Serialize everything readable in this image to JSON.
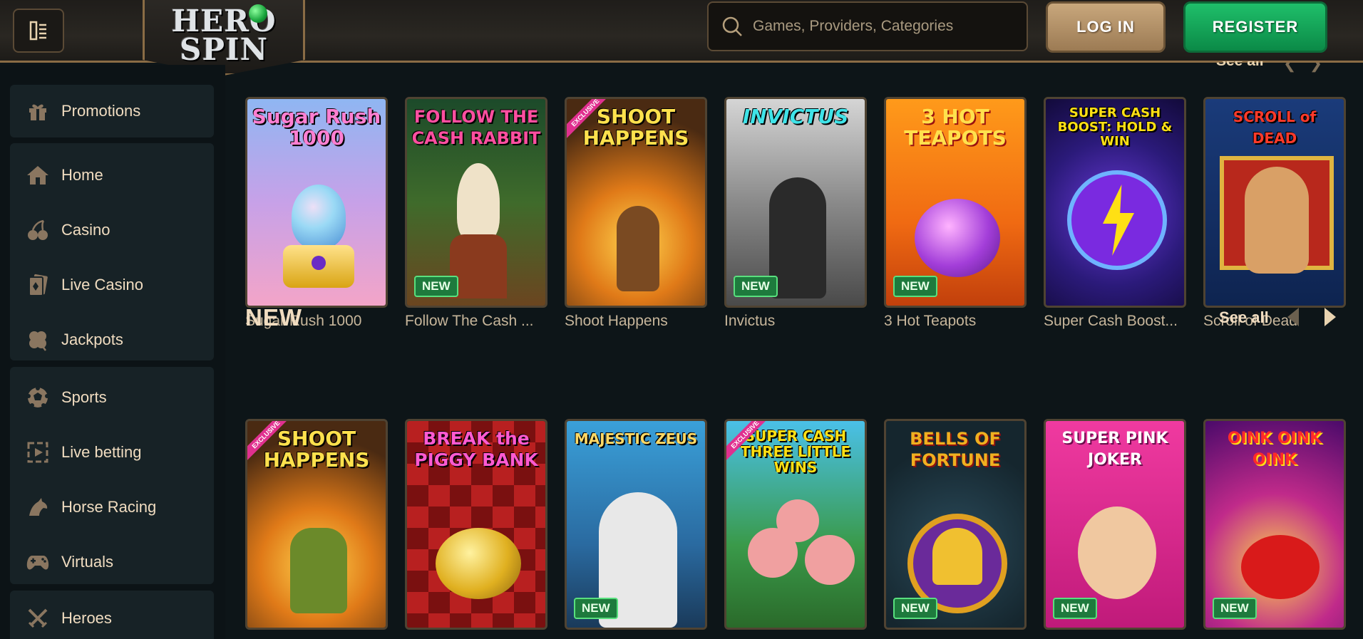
{
  "header": {
    "logo_line1": "HERO",
    "logo_line2": "SPIN",
    "search_placeholder": "Games, Providers, Categories",
    "login_label": "LOG IN",
    "register_label": "REGISTER",
    "top_see_all": "See all"
  },
  "sidebar": {
    "items": [
      {
        "label": "Promotions",
        "icon": "gift-icon"
      },
      {
        "label": "Home",
        "icon": "home-icon"
      },
      {
        "label": "Casino",
        "icon": "cherries-icon"
      },
      {
        "label": "Live Casino",
        "icon": "cards-icon"
      },
      {
        "label": "Jackpots",
        "icon": "clover-icon"
      },
      {
        "label": "Sports",
        "icon": "soccer-ball-icon"
      },
      {
        "label": "Live betting",
        "icon": "live-play-icon"
      },
      {
        "label": "Horse Racing",
        "icon": "horse-icon"
      },
      {
        "label": "Virtuals",
        "icon": "gamepad-icon"
      },
      {
        "label": "Heroes",
        "icon": "crossed-swords-icon"
      }
    ]
  },
  "row1": {
    "games": [
      {
        "name": "Sugar Rush 1000",
        "art_title": "Sugar Rush 1000",
        "new": false,
        "exclusive": false
      },
      {
        "name": "Follow The Cash ...",
        "art_title": "FOLLOW THE CASH RABBIT",
        "new": true,
        "exclusive": false
      },
      {
        "name": "Shoot Happens",
        "art_title": "SHOOT HAPPENS",
        "new": false,
        "exclusive": true
      },
      {
        "name": "Invictus",
        "art_title": "INVICTUS",
        "new": true,
        "exclusive": false
      },
      {
        "name": "3 Hot Teapots",
        "art_title": "3 HOT TEAPOTS",
        "new": true,
        "exclusive": false
      },
      {
        "name": "Super Cash Boost...",
        "art_title": "SUPER CASH BOOST: HOLD & WIN",
        "new": false,
        "exclusive": false
      },
      {
        "name": "Scroll of Dead",
        "art_title": "SCROLL of DEAD",
        "new": false,
        "exclusive": false
      }
    ]
  },
  "new_section": {
    "title": "NEW",
    "see_all": "See all",
    "games": [
      {
        "art_title": "SHOOT HAPPENS",
        "new": false,
        "exclusive": true
      },
      {
        "art_title": "BREAK the PIGGY BANK",
        "new": false,
        "exclusive": false
      },
      {
        "art_title": "MAJESTIC ZEUS",
        "new": true,
        "exclusive": false
      },
      {
        "art_title": "SUPER CASH THREE LITTLE WINS",
        "new": false,
        "exclusive": true
      },
      {
        "art_title": "BELLS OF FORTUNE",
        "new": true,
        "exclusive": false
      },
      {
        "art_title": "SUPER PINK JOKER",
        "new": true,
        "exclusive": false
      },
      {
        "art_title": "OINK OINK OINK",
        "new": true,
        "exclusive": false
      }
    ]
  },
  "badges": {
    "new": "NEW",
    "exclusive": "EXCLUSIVE"
  },
  "colors": {
    "accent_gold": "#c8a77c",
    "register_green": "#1fbf6a",
    "badge_green": "#1e7a3d",
    "background": "#0d1518"
  }
}
